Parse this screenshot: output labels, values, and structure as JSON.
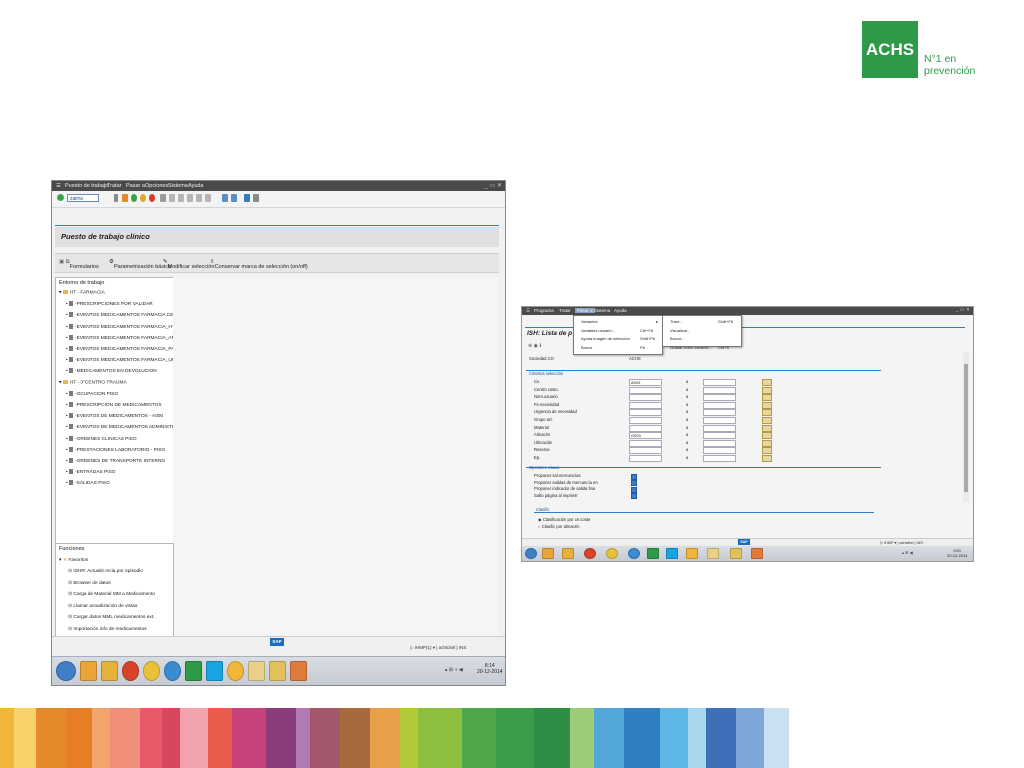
{
  "logo": {
    "brand": "ACHS",
    "tagline_line1": "N°1 en",
    "tagline_line2": "prevención",
    "color": "#2e9a48"
  },
  "stripes": [
    "#f0b63a",
    "#f7d36a",
    "#e48a2a",
    "#e77e25",
    "#f2a56b",
    "#ef8f7a",
    "#e85a6a",
    "#d9475e",
    "#f3a3ae",
    "#e95a4c",
    "#c7417a",
    "#8a3d7a",
    "#b07bb5",
    "#a4566b",
    "#a76a3f",
    "#e9a04a",
    "#b2c93a",
    "#8dbf3f",
    "#4da64a",
    "#3b9d48",
    "#2f8e46",
    "#9ecb7a",
    "#50a7d8",
    "#2f7fc1",
    "#5fb7e6",
    "#a6d7ef",
    "#3f6fb6",
    "#7fa6d8",
    "#c9e0f2"
  ],
  "window1": {
    "menu": [
      "Puesto de trabajo",
      "Tratar",
      "Pasar a",
      "Opciones",
      "Sistema",
      "Ayuda"
    ],
    "command_value": "zaims",
    "title": "Puesto de trabajo clínico",
    "appbar": {
      "formulario": "Formularios",
      "param": "Parametrización básica",
      "modify": "Modificar selección",
      "keep": "Conservar marca de selección (on/off)"
    },
    "tree_header": "Entorno de trabajo",
    "tree": [
      {
        "label": "HT - FARMACIA",
        "type": "folder",
        "level": 0
      },
      {
        "label": "-PRESCRIPCIONES POR VALIDAR",
        "type": "doc",
        "level": 1
      },
      {
        "label": "-EVENTOS MEDICAMENTOS FARMACIA CENTRAL",
        "type": "doc",
        "level": 1
      },
      {
        "label": "-EVENTOS MEDICAMENTOS FARMACIA_HTURG",
        "type": "doc",
        "level": 1
      },
      {
        "label": "-EVENTOS MEDICAMENTOS FARMACIA_AMB",
        "type": "doc",
        "level": 1
      },
      {
        "label": "-EVENTOS MEDICAMENTOS FARMACIA_PABELL",
        "type": "doc",
        "level": 1
      },
      {
        "label": "-EVENTOS MEDICAMENTOS FARMACIA_UPC",
        "type": "doc",
        "level": 1
      },
      {
        "label": "-MEDICAMENTOS EN DEVOLUCION",
        "type": "doc",
        "level": 1
      },
      {
        "label": "HT - 3°CENTRO TRAUMA",
        "type": "folder",
        "level": 0
      },
      {
        "label": "-OCUPACION PISO",
        "type": "doc",
        "level": 1
      },
      {
        "label": "-PRESCRIPCION DE MEDICAMENTOS",
        "type": "doc",
        "level": 1
      },
      {
        "label": "-EVENTOS DE MEDICAMENTOS - A000",
        "type": "doc",
        "level": 1
      },
      {
        "label": "-EVENTOS DE MEDICAMENTOS ADMINISTRADOS -",
        "type": "doc",
        "level": 1
      },
      {
        "label": "-ORDENES CLINICAS PISO",
        "type": "doc",
        "level": 1
      },
      {
        "label": "-PRESTACIONES LABORATORIO - PISO",
        "type": "doc",
        "level": 1
      },
      {
        "label": "-ORDENES DE TRANSPORTE INTERNO",
        "type": "doc",
        "level": 1
      },
      {
        "label": "-ENTRADAS PISO",
        "type": "doc",
        "level": 1
      },
      {
        "label": "-SALIDAS PISO",
        "type": "doc",
        "level": 1
      }
    ],
    "functions_header": "Funciones",
    "favorites_label": "Favoritos",
    "functions": [
      "ISHR: Actualiz.mcia.por episodio",
      "Browser de datos",
      "Carga de Material MM a Medicamento",
      "Llamar actualización de vistas",
      "Cargar datos MML medicamentos ext.",
      "Importación info de medicamentos"
    ],
    "status": {
      "sap": "SAP",
      "system": "IHMP(1)",
      "user": "achtcitel",
      "mode": "INS"
    },
    "clock": {
      "time": "8:14",
      "date": "20-12-2014"
    }
  },
  "window2": {
    "menu": [
      "Programa",
      "Tratar",
      "Pasar a",
      "Sistema",
      "Ayuda"
    ],
    "dropdown": [
      {
        "label": "Variantes",
        "shortcut": ""
      },
      {
        "label": "Variables usuario...",
        "shortcut": "Ctrl+F6"
      },
      {
        "label": "Ayuda imagen de selección",
        "shortcut": "Shift+F6"
      },
      {
        "label": "Borrar",
        "shortcut": "F8"
      }
    ],
    "submenu": [
      {
        "label": "Traer...",
        "shortcut": "Shift+F5"
      },
      {
        "label": "Visualizar...",
        "shortcut": ""
      },
      {
        "label": "Borrar...",
        "shortcut": ""
      },
      {
        "label": "Grabar como variante...",
        "shortcut": "Ctrl+S"
      }
    ],
    "title": "ISH: Lista de p",
    "sociedad_label": "Sociedad CO",
    "sociedad_value": "ACHS",
    "section_criteria": "Criterios selección",
    "fields": [
      "Ce.",
      "Centro costo",
      "Nom.usuario",
      "Fe.necesidad",
      "Urgencia de necesidad",
      "Grupo art.",
      "Material",
      "Almacén",
      "Ubicación",
      "Reserva",
      "Ep."
    ],
    "ce_value": "A003",
    "almacen_value": "G003",
    "to_label": "a",
    "section_options": "Opciones visual.",
    "options": [
      "Proponer sal.mercancías",
      "Proponer salidas de mercancía en",
      "Proponer indicador de salida fina",
      "Salto página al imprimir"
    ],
    "section_classif": "Clasific",
    "radios": [
      "Clasificación por ce.coste",
      "Clasific por almacén"
    ],
    "status": {
      "sap": "SAP",
      "system": "IHMP",
      "user": "achtcitel",
      "mode": "INS"
    },
    "clock": {
      "time": "9:01",
      "date": "20-12-2014"
    }
  }
}
